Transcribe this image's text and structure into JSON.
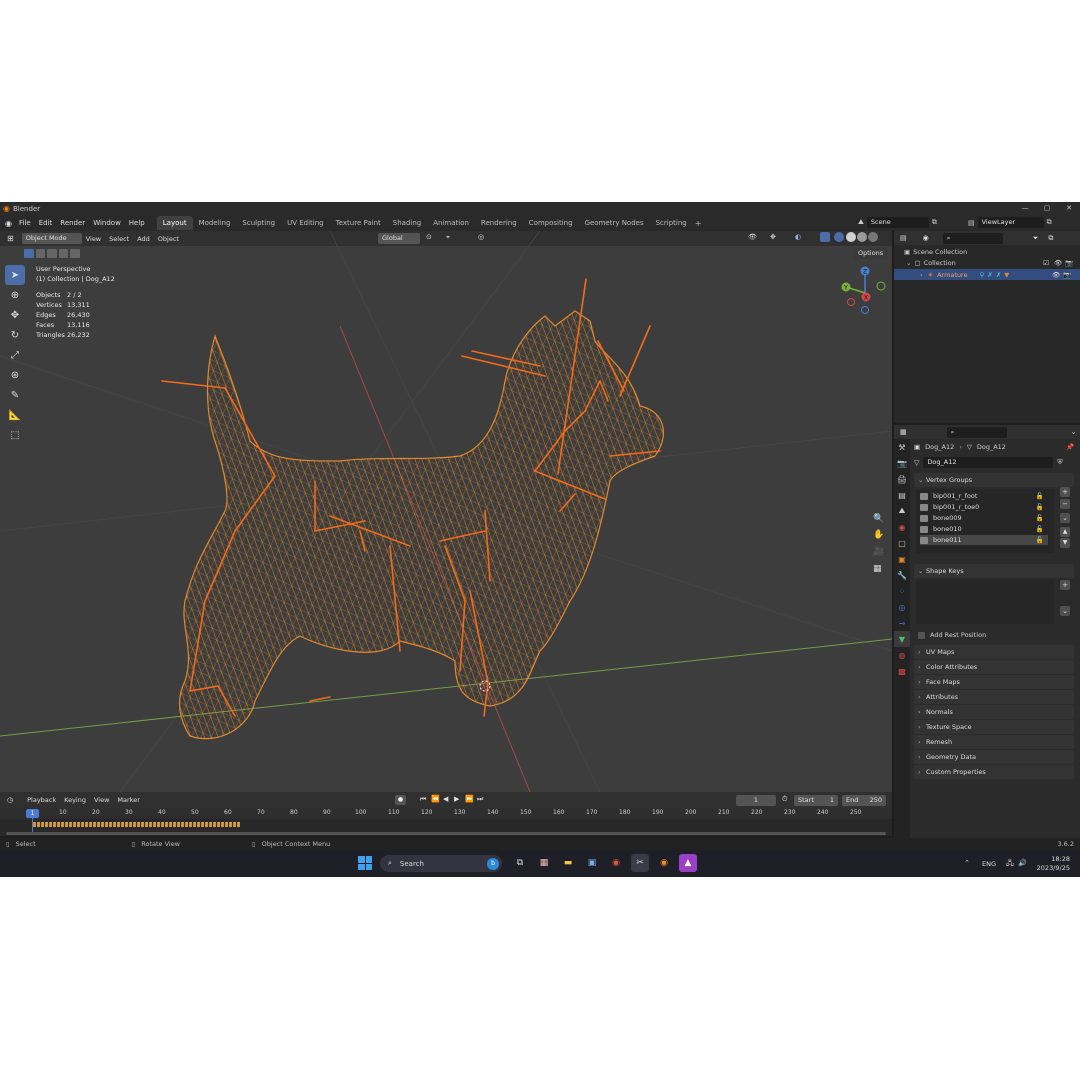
{
  "window": {
    "title": "Blender"
  },
  "menu": {
    "items": [
      "File",
      "Edit",
      "Render",
      "Window",
      "Help"
    ],
    "workspaces": [
      "Layout",
      "Modeling",
      "Sculpting",
      "UV Editing",
      "Texture Paint",
      "Shading",
      "Animation",
      "Rendering",
      "Compositing",
      "Geometry Nodes",
      "Scripting"
    ],
    "active_workspace": "Layout",
    "scene": "Scene",
    "view_layer": "ViewLayer"
  },
  "viewport_header": {
    "mode": "Object Mode",
    "menus": [
      "View",
      "Select",
      "Add",
      "Object"
    ],
    "orientation": "Global",
    "options": "Options"
  },
  "viewport": {
    "perspective": "User Perspective",
    "context": "(1) Collection | Dog_A12",
    "stats": [
      {
        "label": "Objects",
        "value": "2 / 2"
      },
      {
        "label": "Vertices",
        "value": "13,311"
      },
      {
        "label": "Edges",
        "value": "26,430"
      },
      {
        "label": "Faces",
        "value": "13,116"
      },
      {
        "label": "Triangles",
        "value": "26,232"
      }
    ],
    "gizmo_axes": [
      "Z",
      "Y",
      "X"
    ],
    "wire_color": "#e08a2a",
    "bone_color": "#f26a1b"
  },
  "outliner": {
    "root": "Scene Collection",
    "collection": "Collection",
    "object": "Armature"
  },
  "properties": {
    "breadcrumb_object": "Dog_A12",
    "breadcrumb_data": "Dog_A12",
    "data_name": "Dog_A12",
    "vertex_groups_title": "Vertex Groups",
    "vertex_groups": [
      "bip001_r_foot",
      "bip001_r_toe0",
      "bone009",
      "bone010",
      "bone011"
    ],
    "shape_keys_title": "Shape Keys",
    "add_rest_position": "Add Rest Position",
    "panels": [
      "UV Maps",
      "Color Attributes",
      "Face Maps",
      "Attributes",
      "Normals",
      "Texture Space",
      "Remesh",
      "Geometry Data",
      "Custom Properties"
    ]
  },
  "timeline": {
    "menus": [
      "Playback",
      "Keying",
      "View",
      "Marker"
    ],
    "current_frame": "1",
    "start_label": "Start",
    "start": "1",
    "end_label": "End",
    "end": "250",
    "ticks": [
      "1",
      "10",
      "20",
      "30",
      "40",
      "50",
      "60",
      "70",
      "80",
      "90",
      "100",
      "110",
      "120",
      "130",
      "140",
      "150",
      "160",
      "170",
      "180",
      "190",
      "200",
      "210",
      "220",
      "230",
      "240",
      "250"
    ]
  },
  "statusbar": {
    "select": "Select",
    "rotate": "Rotate View",
    "context_menu": "Object Context Menu",
    "version": "3.6.2"
  },
  "taskbar": {
    "search": "Search",
    "lang": "ENG",
    "time": "18:28",
    "date": "2023/9/25"
  }
}
